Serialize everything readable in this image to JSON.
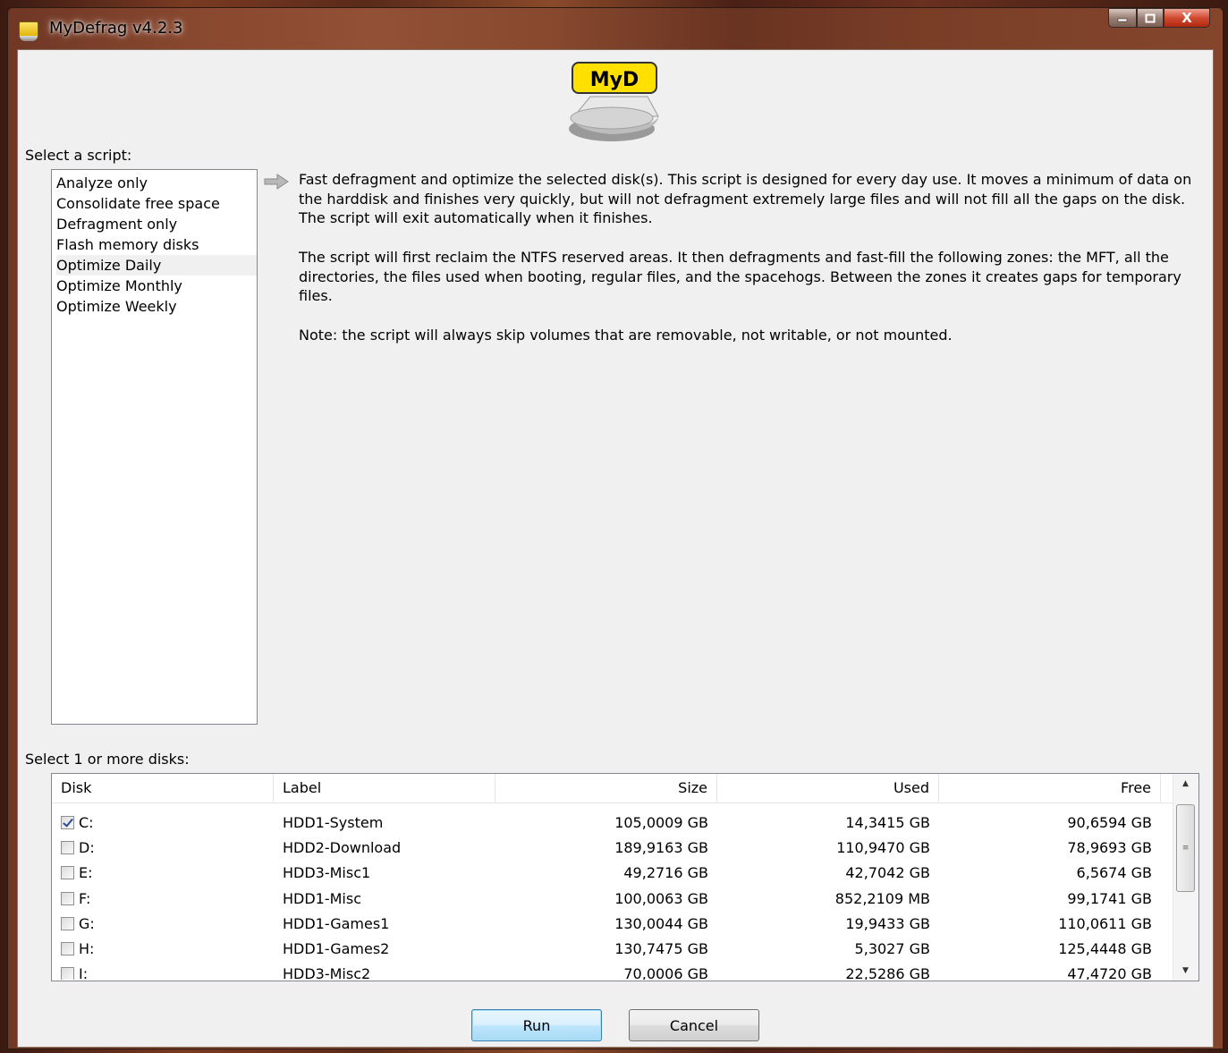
{
  "window": {
    "title": "MyDefrag v4.2.3",
    "buttons": {
      "minimize": "minimize",
      "maximize": "maximize",
      "close": "X"
    }
  },
  "logo": {
    "text": "MyD"
  },
  "script_section": {
    "label": "Select a script:",
    "items": [
      "Analyze only",
      "Consolidate free space",
      "Defragment only",
      "Flash memory disks",
      "Optimize Daily",
      "Optimize Monthly",
      "Optimize Weekly"
    ],
    "selected_index": 4
  },
  "description": {
    "paragraphs": [
      "Fast defragment and optimize the selected disk(s). This script is designed for every day use. It moves a minimum of data on the harddisk and finishes very quickly, but will not defragment extremely large files and will not fill all the gaps on the disk. The script will exit automatically when it finishes.",
      "The script will first reclaim the NTFS reserved areas. It then defragments and fast-fill the following zones: the MFT, all the directories, the files used when booting, regular files, and the spacehogs. Between the zones it  creates gaps for temporary files.",
      "Note: the script will always skip volumes that are removable, not writable, or not mounted."
    ]
  },
  "disk_section": {
    "label": "Select 1 or more disks:",
    "columns": [
      "Disk",
      "Label",
      "Size",
      "Used",
      "Free"
    ],
    "rows": [
      {
        "checked": true,
        "disk": "C:",
        "label": "HDD1-System",
        "size": "105,0009 GB",
        "used": "14,3415 GB",
        "free": "90,6594 GB"
      },
      {
        "checked": false,
        "disk": "D:",
        "label": "HDD2-Download",
        "size": "189,9163 GB",
        "used": "110,9470 GB",
        "free": "78,9693 GB"
      },
      {
        "checked": false,
        "disk": "E:",
        "label": "HDD3-Misc1",
        "size": "49,2716 GB",
        "used": "42,7042 GB",
        "free": "6,5674 GB"
      },
      {
        "checked": false,
        "disk": "F:",
        "label": "HDD1-Misc",
        "size": "100,0063 GB",
        "used": "852,2109 MB",
        "free": "99,1741 GB"
      },
      {
        "checked": false,
        "disk": "G:",
        "label": "HDD1-Games1",
        "size": "130,0044 GB",
        "used": "19,9433 GB",
        "free": "110,0611 GB"
      },
      {
        "checked": false,
        "disk": "H:",
        "label": "HDD1-Games2",
        "size": "130,7475 GB",
        "used": "5,3027 GB",
        "free": "125,4448 GB"
      },
      {
        "checked": false,
        "disk": "I:",
        "label": "HDD3-Misc2",
        "size": "70,0006 GB",
        "used": "22,5286 GB",
        "free": "47,4720 GB"
      }
    ]
  },
  "buttons": {
    "run": "Run",
    "cancel": "Cancel"
  }
}
